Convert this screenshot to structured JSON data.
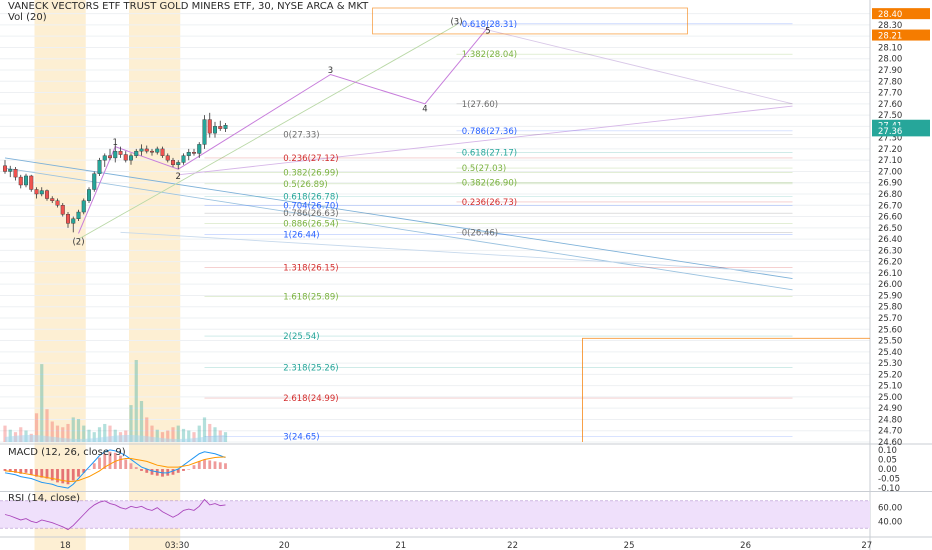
{
  "header": {
    "title": "VANECK VECTORS ETF TRUST GOLD MINERS ETF, 30, NYSE ARCA & MKT",
    "volume_label": "Vol (20)",
    "macd_label": "MACD (12, 26, close, 9)",
    "rsi_label": "RSI (14, close)"
  },
  "colors": {
    "up": "#26a69a",
    "down": "#ef5350",
    "session": "#fdeccb",
    "fib_red": "#d32f2f",
    "fib_green": "#7cb342",
    "fib_teal": "#26a69a",
    "fib_blue": "#2962ff",
    "fib_gray": "#6d6d6d",
    "wave": "#c77ddb",
    "accent_orange": "#f57c00",
    "rsi_fill": "#efe0fb"
  },
  "chart_data": [
    {
      "type": "candlestick",
      "title": "VANECK VECTORS ETF TRUST GOLD MINERS ETF, 30, NYSE ARCA & MKT",
      "ylim": [
        24.6,
        28.45
      ],
      "y_ticks": [
        "28.40",
        "28.30",
        "28.20",
        "28.10",
        "28.00",
        "27.90",
        "27.80",
        "27.70",
        "27.60",
        "27.50",
        "27.40",
        "27.30",
        "27.20",
        "27.10",
        "27.00",
        "26.90",
        "26.80",
        "26.70",
        "26.60",
        "26.50",
        "26.40",
        "26.30",
        "26.20",
        "26.10",
        "26.00",
        "25.90",
        "25.80",
        "25.70",
        "25.60",
        "25.50",
        "25.40",
        "25.30",
        "25.20",
        "25.10",
        "25.00",
        "24.90",
        "24.80",
        "24.70",
        "24.60"
      ],
      "x_labels": [
        {
          "label": "18",
          "pos": 0.07
        },
        {
          "label": "03:30",
          "pos": 0.19
        },
        {
          "label": "20",
          "pos": 0.305
        },
        {
          "label": "21",
          "pos": 0.43
        },
        {
          "label": "22",
          "pos": 0.55
        },
        {
          "label": "25",
          "pos": 0.675
        },
        {
          "label": "26",
          "pos": 0.8
        },
        {
          "label": "27",
          "pos": 0.93
        }
      ],
      "price_badges": [
        {
          "value": "28.40",
          "color": "#f57c00"
        },
        {
          "value": "28.21",
          "color": "#f57c00"
        },
        {
          "value": "27.41",
          "color": "#26a69a"
        },
        {
          "value": "27.36",
          "color": "#26a69a"
        }
      ],
      "candles": [
        {
          "o": 27.05,
          "h": 27.1,
          "l": 26.98,
          "c": 27.0
        },
        {
          "o": 27.0,
          "h": 27.05,
          "l": 26.95,
          "c": 27.02
        },
        {
          "o": 27.02,
          "h": 27.04,
          "l": 26.92,
          "c": 26.95
        },
        {
          "o": 26.95,
          "h": 26.97,
          "l": 26.85,
          "c": 26.88
        },
        {
          "o": 26.88,
          "h": 26.98,
          "l": 26.86,
          "c": 26.96
        },
        {
          "o": 26.96,
          "h": 26.97,
          "l": 26.82,
          "c": 26.84
        },
        {
          "o": 26.84,
          "h": 26.86,
          "l": 26.76,
          "c": 26.8
        },
        {
          "o": 26.8,
          "h": 26.86,
          "l": 26.78,
          "c": 26.83
        },
        {
          "o": 26.83,
          "h": 26.84,
          "l": 26.74,
          "c": 26.76
        },
        {
          "o": 26.76,
          "h": 26.78,
          "l": 26.72,
          "c": 26.74
        },
        {
          "o": 26.74,
          "h": 26.76,
          "l": 26.68,
          "c": 26.7
        },
        {
          "o": 26.7,
          "h": 26.72,
          "l": 26.6,
          "c": 26.62
        },
        {
          "o": 26.62,
          "h": 26.64,
          "l": 26.5,
          "c": 26.54
        },
        {
          "o": 26.54,
          "h": 26.6,
          "l": 26.46,
          "c": 26.58
        },
        {
          "o": 26.58,
          "h": 26.66,
          "l": 26.56,
          "c": 26.64
        },
        {
          "o": 26.64,
          "h": 26.76,
          "l": 26.62,
          "c": 26.74
        },
        {
          "o": 26.74,
          "h": 26.86,
          "l": 26.72,
          "c": 26.84
        },
        {
          "o": 26.84,
          "h": 27.0,
          "l": 26.82,
          "c": 26.98
        },
        {
          "o": 26.98,
          "h": 27.12,
          "l": 26.96,
          "c": 27.1
        },
        {
          "o": 27.1,
          "h": 27.16,
          "l": 27.04,
          "c": 27.14
        },
        {
          "o": 27.14,
          "h": 27.2,
          "l": 27.1,
          "c": 27.12
        },
        {
          "o": 27.12,
          "h": 27.24,
          "l": 27.08,
          "c": 27.18
        },
        {
          "o": 27.18,
          "h": 27.22,
          "l": 27.12,
          "c": 27.15
        },
        {
          "o": 27.15,
          "h": 27.18,
          "l": 27.08,
          "c": 27.1
        },
        {
          "o": 27.1,
          "h": 27.16,
          "l": 27.06,
          "c": 27.14
        },
        {
          "o": 27.14,
          "h": 27.2,
          "l": 27.12,
          "c": 27.18
        },
        {
          "o": 27.18,
          "h": 27.24,
          "l": 27.14,
          "c": 27.2
        },
        {
          "o": 27.2,
          "h": 27.23,
          "l": 27.16,
          "c": 27.18
        },
        {
          "o": 27.18,
          "h": 27.2,
          "l": 27.14,
          "c": 27.17
        },
        {
          "o": 27.17,
          "h": 27.22,
          "l": 27.15,
          "c": 27.2
        },
        {
          "o": 27.2,
          "h": 27.22,
          "l": 27.12,
          "c": 27.14
        },
        {
          "o": 27.14,
          "h": 27.16,
          "l": 27.08,
          "c": 27.1
        },
        {
          "o": 27.1,
          "h": 27.12,
          "l": 27.04,
          "c": 27.06
        },
        {
          "o": 27.06,
          "h": 27.1,
          "l": 27.02,
          "c": 27.08
        },
        {
          "o": 27.08,
          "h": 27.16,
          "l": 27.06,
          "c": 27.14
        },
        {
          "o": 27.14,
          "h": 27.2,
          "l": 27.1,
          "c": 27.17
        },
        {
          "o": 27.17,
          "h": 27.2,
          "l": 27.14,
          "c": 27.16
        },
        {
          "o": 27.16,
          "h": 27.26,
          "l": 27.12,
          "c": 27.24
        },
        {
          "o": 27.24,
          "h": 27.5,
          "l": 27.2,
          "c": 27.46
        },
        {
          "o": 27.46,
          "h": 27.52,
          "l": 27.3,
          "c": 27.34
        },
        {
          "o": 27.34,
          "h": 27.44,
          "l": 27.3,
          "c": 27.4
        },
        {
          "o": 27.4,
          "h": 27.45,
          "l": 27.36,
          "c": 27.38
        },
        {
          "o": 27.38,
          "h": 27.43,
          "l": 27.35,
          "c": 27.41
        }
      ],
      "sessions": [
        [
          6,
          15
        ],
        [
          24,
          33
        ]
      ],
      "wave_labels": [
        {
          "text": "(2)",
          "i": 14,
          "y": 26.38
        },
        {
          "text": "1",
          "i": 21,
          "y": 27.26
        },
        {
          "text": "2",
          "i": 33,
          "y": 26.96
        },
        {
          "text": "3",
          "i": 62,
          "y": 27.9
        },
        {
          "text": "4",
          "i": 80,
          "y": 27.56
        },
        {
          "text": "(3)",
          "i": 86,
          "y": 28.33
        },
        {
          "text": "5",
          "i": 92,
          "y": 28.25
        }
      ],
      "fib_levels": [
        {
          "label": "0(27.33)",
          "value": 27.33,
          "color": "#6d6d6d",
          "i0": 38,
          "i1": 150,
          "lx": 53
        },
        {
          "label": "0.236(27.12)",
          "value": 27.12,
          "color": "#d32f2f",
          "i0": 38,
          "i1": 150,
          "lx": 53
        },
        {
          "label": "0.382(26.99)",
          "value": 26.99,
          "color": "#7cb342",
          "i0": 38,
          "i1": 150,
          "lx": 53
        },
        {
          "label": "0.5(26.89)",
          "value": 26.89,
          "color": "#7cb342",
          "i0": 38,
          "i1": 150,
          "lx": 53
        },
        {
          "label": "0.618(26.78)",
          "value": 26.78,
          "color": "#26a69a",
          "i0": 38,
          "i1": 150,
          "lx": 53
        },
        {
          "label": "0.704(26.70)",
          "value": 26.7,
          "color": "#2962ff",
          "i0": 38,
          "i1": 150,
          "lx": 53
        },
        {
          "label": "0.786(26.63)",
          "value": 26.63,
          "color": "#6d6d6d",
          "i0": 38,
          "i1": 150,
          "lx": 53
        },
        {
          "label": "0.886(26.54)",
          "value": 26.54,
          "color": "#7cb342",
          "i0": 38,
          "i1": 150,
          "lx": 53
        },
        {
          "label": "1(26.44)",
          "value": 26.44,
          "color": "#2962ff",
          "i0": 38,
          "i1": 150,
          "lx": 53
        },
        {
          "label": "1.318(26.15)",
          "value": 26.15,
          "color": "#d32f2f",
          "i0": 38,
          "i1": 150,
          "lx": 53
        },
        {
          "label": "1.618(25.89)",
          "value": 25.89,
          "color": "#7cb342",
          "i0": 38,
          "i1": 150,
          "lx": 53
        },
        {
          "label": "2(25.54)",
          "value": 25.54,
          "color": "#26a69a",
          "i0": 38,
          "i1": 150,
          "lx": 53
        },
        {
          "label": "2.318(25.26)",
          "value": 25.26,
          "color": "#26a69a",
          "i0": 38,
          "i1": 150,
          "lx": 53
        },
        {
          "label": "2.618(24.99)",
          "value": 24.99,
          "color": "#d32f2f",
          "i0": 38,
          "i1": 150,
          "lx": 53
        },
        {
          "label": "3(24.65)",
          "value": 24.65,
          "color": "#2962ff",
          "i0": 38,
          "i1": 150,
          "lx": 53
        },
        {
          "label": "0.618(28.31)",
          "value": 28.31,
          "color": "#2962ff",
          "i0": 86,
          "i1": 150,
          "lx": 87
        },
        {
          "label": "1.382(28.04)",
          "value": 28.04,
          "color": "#7cb342",
          "i0": 86,
          "i1": 150,
          "lx": 87
        },
        {
          "label": "1(27.60)",
          "value": 27.6,
          "color": "#6d6d6d",
          "i0": 86,
          "i1": 150,
          "lx": 87
        },
        {
          "label": "0.786(27.36)",
          "value": 27.36,
          "color": "#2962ff",
          "i0": 86,
          "i1": 150,
          "lx": 87
        },
        {
          "label": "0.618(27.17)",
          "value": 27.17,
          "color": "#26a69a",
          "i0": 86,
          "i1": 150,
          "lx": 87
        },
        {
          "label": "0.5(27.03)",
          "value": 27.03,
          "color": "#7cb342",
          "i0": 86,
          "i1": 150,
          "lx": 87
        },
        {
          "label": "0.382(26.90)",
          "value": 26.9,
          "color": "#7cb342",
          "i0": 86,
          "i1": 150,
          "lx": 87
        },
        {
          "label": "0.236(26.73)",
          "value": 26.73,
          "color": "#d32f2f",
          "i0": 86,
          "i1": 150,
          "lx": 87
        },
        {
          "label": "0(26.46)",
          "value": 26.46,
          "color": "#6d6d6d",
          "i0": 86,
          "i1": 150,
          "lx": 87
        }
      ],
      "volume": [
        0.2,
        0.15,
        0.12,
        0.18,
        0.14,
        0.1,
        0.35,
        0.95,
        0.4,
        0.25,
        0.2,
        0.18,
        0.22,
        0.3,
        0.28,
        0.2,
        0.15,
        0.12,
        0.18,
        0.22,
        0.2,
        0.15,
        0.12,
        0.14,
        0.45,
        1.0,
        0.5,
        0.3,
        0.2,
        0.15,
        0.12,
        0.14,
        0.18,
        0.2,
        0.16,
        0.14,
        0.12,
        0.2,
        0.3,
        0.22,
        0.18,
        0.14,
        0.12
      ]
    },
    {
      "type": "bar",
      "title": "MACD (12, 26, close, 9)",
      "y_ticks": [
        "0.10",
        "0.05",
        "0.00",
        "-0.05",
        "-0.10"
      ],
      "ylim": [
        -0.11,
        0.11
      ],
      "histogram": [
        -0.01,
        -0.015,
        -0.02,
        -0.025,
        -0.02,
        -0.03,
        -0.04,
        -0.045,
        -0.05,
        -0.06,
        -0.07,
        -0.075,
        -0.08,
        -0.06,
        -0.04,
        -0.02,
        0.0,
        0.03,
        0.06,
        0.08,
        0.09,
        0.085,
        0.07,
        0.05,
        0.03,
        0.01,
        -0.01,
        -0.02,
        -0.03,
        -0.035,
        -0.04,
        -0.035,
        -0.03,
        -0.02,
        -0.01,
        0.0,
        0.02,
        0.04,
        0.05,
        0.045,
        0.04,
        0.035,
        0.03
      ],
      "macd_line": [
        -0.02,
        -0.025,
        -0.03,
        -0.04,
        -0.045,
        -0.05,
        -0.06,
        -0.07,
        -0.075,
        -0.08,
        -0.09,
        -0.095,
        -0.1,
        -0.08,
        -0.05,
        -0.02,
        0.01,
        0.04,
        0.07,
        0.09,
        0.1,
        0.095,
        0.085,
        0.07,
        0.05,
        0.03,
        0.01,
        0.0,
        -0.01,
        -0.015,
        -0.02,
        -0.02,
        -0.01,
        0.0,
        0.02,
        0.04,
        0.06,
        0.08,
        0.09,
        0.085,
        0.08,
        0.07,
        0.06
      ],
      "signal_line": [
        -0.01,
        -0.012,
        -0.015,
        -0.02,
        -0.025,
        -0.03,
        -0.035,
        -0.04,
        -0.045,
        -0.05,
        -0.055,
        -0.06,
        -0.065,
        -0.065,
        -0.06,
        -0.05,
        -0.04,
        -0.025,
        -0.01,
        0.01,
        0.025,
        0.04,
        0.05,
        0.055,
        0.055,
        0.05,
        0.045,
        0.04,
        0.03,
        0.02,
        0.015,
        0.01,
        0.01,
        0.01,
        0.015,
        0.02,
        0.03,
        0.04,
        0.05,
        0.055,
        0.06,
        0.062,
        0.063
      ]
    },
    {
      "type": "line",
      "title": "RSI (14, close)",
      "y_ticks": [
        "60.00",
        "40.00"
      ],
      "ylim": [
        20,
        80
      ],
      "band": [
        30,
        70
      ],
      "values": [
        50,
        48,
        45,
        42,
        44,
        40,
        38,
        42,
        40,
        38,
        35,
        32,
        28,
        34,
        42,
        50,
        58,
        64,
        68,
        70,
        66,
        64,
        60,
        58,
        62,
        60,
        62,
        58,
        56,
        60,
        54,
        50,
        46,
        50,
        56,
        58,
        56,
        62,
        72,
        64,
        66,
        63,
        64
      ]
    }
  ]
}
